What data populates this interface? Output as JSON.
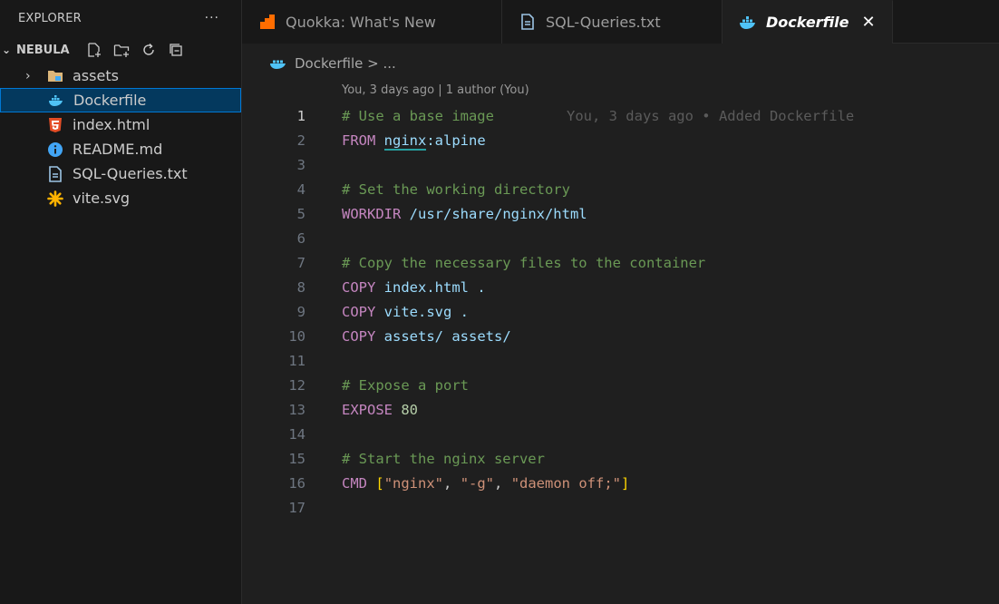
{
  "explorer": {
    "title": "EXPLORER",
    "more": "···",
    "folder": "NEBULA",
    "items": [
      {
        "label": "assets",
        "icon": "folder-icon",
        "type": "folder"
      },
      {
        "label": "Dockerfile",
        "icon": "docker-icon",
        "selected": true
      },
      {
        "label": "index.html",
        "icon": "html5-icon"
      },
      {
        "label": "README.md",
        "icon": "info-icon"
      },
      {
        "label": "SQL-Queries.txt",
        "icon": "text-file-icon"
      },
      {
        "label": "vite.svg",
        "icon": "svg-icon"
      }
    ]
  },
  "tabs": [
    {
      "label": "Quokka: What's New",
      "icon": "quokka-icon"
    },
    {
      "label": "SQL-Queries.txt",
      "icon": "text-file-icon"
    },
    {
      "label": "Dockerfile",
      "icon": "docker-icon",
      "active": true,
      "close": "✕"
    }
  ],
  "breadcrumb": "Dockerfile > ...",
  "codelens": "You, 3 days ago | 1 author (You)",
  "blame": "You, 3 days ago • Added Dockerfile",
  "lines": {
    "l1": "# Use a base image",
    "l2_kw": "FROM",
    "l2_id": "nginx",
    "l2_rest": ":alpine",
    "l4": "# Set the working directory",
    "l5_kw": "WORKDIR",
    "l5_rest": "/usr/share/nginx/html",
    "l7": "# Copy the necessary files to the container",
    "l8_kw": "COPY",
    "l8_rest": "index.html .",
    "l9_kw": "COPY",
    "l9_rest": "vite.svg .",
    "l10_kw": "COPY",
    "l10_rest": "assets/ assets/",
    "l12": "# Expose a port",
    "l13_kw": "EXPOSE",
    "l13_num": "80",
    "l15": "# Start the nginx server",
    "l16_kw": "CMD",
    "l16_open": "[",
    "l16_s1": "\"nginx\"",
    "l16_c1": ", ",
    "l16_s2": "\"-g\"",
    "l16_c2": ", ",
    "l16_s3": "\"daemon off;\"",
    "l16_close": "]"
  },
  "line_numbers": [
    "1",
    "2",
    "3",
    "4",
    "5",
    "6",
    "7",
    "8",
    "9",
    "10",
    "11",
    "12",
    "13",
    "14",
    "15",
    "16",
    "17"
  ]
}
